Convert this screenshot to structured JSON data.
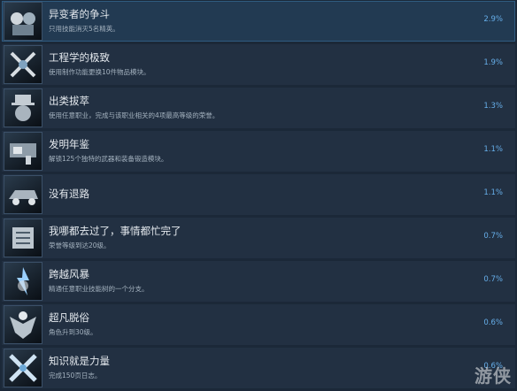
{
  "achievements": [
    {
      "title": "异变者的争斗",
      "desc": "只用技能消灭5名精英。",
      "pct": "2.9%",
      "icon": "crystal-warriors-icon"
    },
    {
      "title": "工程学的极致",
      "desc": "使用制作功能更换10件物品模块。",
      "pct": "1.9%",
      "icon": "crossed-tools-icon"
    },
    {
      "title": "出类拔萃",
      "desc": "使用任意职业，完成与该职业相关的4项最高等级的荣誉。",
      "pct": "1.3%",
      "icon": "top-hat-skull-icon"
    },
    {
      "title": "发明年鉴",
      "desc": "解锁125个独特的武器和装备锻造模块。",
      "pct": "1.1%",
      "icon": "weapon-blueprint-icon"
    },
    {
      "title": "没有退路",
      "desc": "",
      "pct": "1.1%",
      "icon": "vehicle-icon"
    },
    {
      "title": "我哪都去过了，事情都忙完了",
      "desc": "荣誉等级到达20级。",
      "pct": "0.7%",
      "icon": "circuit-cube-icon"
    },
    {
      "title": "跨越风暴",
      "desc": "精通任意职业技能树的一个分支。",
      "pct": "0.7%",
      "icon": "storm-figure-icon"
    },
    {
      "title": "超凡脱俗",
      "desc": "角色升到30级。",
      "pct": "0.6%",
      "icon": "winged-figure-icon"
    },
    {
      "title": "知识就是力量",
      "desc": "完成150页日志。",
      "pct": "0.6%",
      "icon": "crossed-blades-icon"
    }
  ],
  "watermark": "游侠"
}
